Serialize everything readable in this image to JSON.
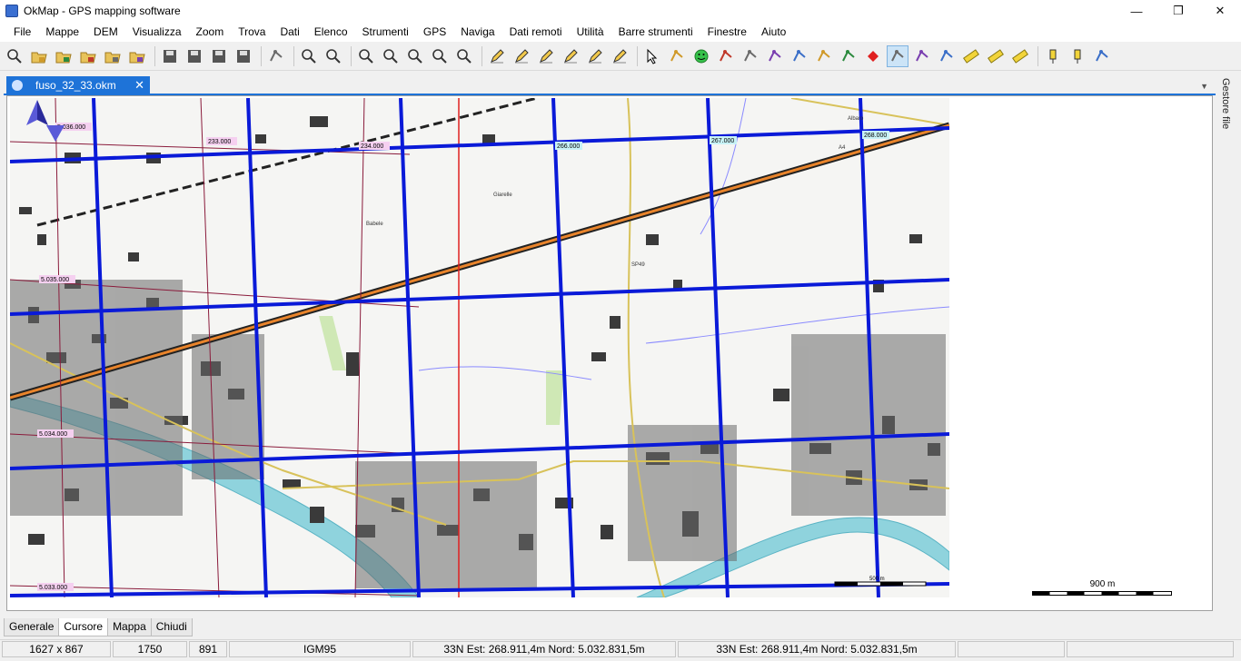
{
  "window": {
    "title": "OkMap - GPS mapping software",
    "controls": [
      "—",
      "❐",
      "✕"
    ]
  },
  "menu": [
    "File",
    "Mappe",
    "DEM",
    "Visualizza",
    "Zoom",
    "Trova",
    "Dati",
    "Elenco",
    "Strumenti",
    "GPS",
    "Naviga",
    "Dati remoti",
    "Utilità",
    "Barre strumenti",
    "Finestre",
    "Aiuto"
  ],
  "toolbar": {
    "icons": [
      "open-map-icon",
      "open-folder-icon",
      "open-folder-gps-icon",
      "open-folder-route-icon",
      "open-folder-red-icon",
      "open-folder-blue-icon",
      "sep",
      "save-icon",
      "save-as-icon",
      "save-gray-icon",
      "save-disabled-icon",
      "sep",
      "layers-icon",
      "sep",
      "map-overview-icon",
      "find-icon",
      "sep",
      "zoom-in-icon",
      "zoom-out-icon",
      "zoom-window-icon",
      "zoom-s-icon",
      "zoom-1to1-icon",
      "sep",
      "edit-icon",
      "edit-points-icon",
      "edit-window-icon",
      "edit-cross-icon",
      "edit-delete-icon",
      "edit-merge-icon",
      "sep",
      "cursor-icon",
      "move-icon",
      "smiley-icon",
      "message-icon",
      "route-points-icon",
      "route-loop-icon",
      "draw-icon",
      "draw-shape-icon",
      "cone-icon",
      "waypoint-red-icon",
      "track-edit-icon",
      "track-split-icon",
      "track-join-icon",
      "ruler-icon",
      "ruler-area-icon",
      "ruler-delete-icon",
      "sep",
      "pin-icon",
      "pin-link-icon",
      "properties-icon"
    ],
    "active_icon": "track-edit-icon"
  },
  "document_tab": {
    "label": "fuso_32_33.okm",
    "close": "✕"
  },
  "side_panel": {
    "label": "Gestore file"
  },
  "map": {
    "grid_labels": [
      "5.036.000",
      "5.035.000",
      "5.034.000",
      "5.033.000",
      "233.000",
      "234.000",
      "266.000",
      "267.000",
      "268.000"
    ],
    "place_labels": [
      "Albaro",
      "Giarelle",
      "Babele",
      "SP49",
      "A4"
    ],
    "inner_scale_label": "500 m",
    "scale_label": "900 m"
  },
  "bottom_tabs": [
    "Generale",
    "Cursore",
    "Mappa",
    "Chiudi"
  ],
  "active_bottom_tab": "Cursore",
  "status": {
    "size": "1627 x 867",
    "x": "1750",
    "y": "891",
    "datum": "IGM95",
    "coord1": "33N  Est: 268.911,4m  Nord: 5.032.831,5m",
    "coord2": "33N  Est: 268.911,4m  Nord: 5.032.831,5m",
    "empty1": "",
    "empty2": ""
  },
  "colors": {
    "tab_blue": "#1e73d8",
    "grid_blue": "#0a1ad8",
    "grid_maroon": "#8a1b3b",
    "highway_orange": "#e9842b",
    "river_cyan": "#86d0dc"
  }
}
